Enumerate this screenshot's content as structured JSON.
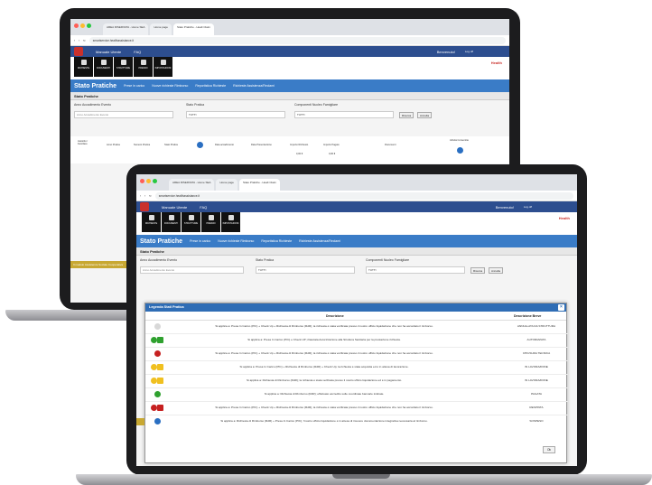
{
  "browser": {
    "tab1": "AREA RISERVATA - Home SEA",
    "tab2": "Home page",
    "tab3": "Stato Pratiche - Healt Claim",
    "url": "smartservice.healthassistance.it"
  },
  "app": {
    "nav_manual": "Manuale Utente",
    "nav_faq": "FAQ",
    "welcome": "Benvenuto!",
    "logout": "Log off",
    "brand": "Health"
  },
  "menu": {
    "items": [
      "RICHIESTE",
      "DOCUMENTI",
      "STRUTTURE",
      "PRESIDI",
      "IMPOSTAZIONI"
    ]
  },
  "page": {
    "title": "Stato Pratiche",
    "links": [
      "Prese in carico",
      "Nuove richieste Rimborso",
      "Reportistica Richieste",
      "Richieste Assistenza/Reclami"
    ],
    "section": "Stato Pratiche"
  },
  "filters": {
    "year_label": "Anno Accadimento Evento",
    "year_placeholder": "Anno Accadimento Evento",
    "state_label": "Stato Pratica",
    "state_value": "TUTTI",
    "family_label": "Componenti Nucleo Famigliare",
    "family_value": "TUTTI",
    "search_btn": "Ricerca",
    "reset_btn": "Annulla"
  },
  "table": {
    "headers": [
      "Assistito / Familiare",
      "Anno Pratica",
      "Numero Pratica",
      "Stato Pratica",
      "Data accadimento",
      "Data Presentazione",
      "Importo Richiesto",
      "Importo Pagato",
      "Documenti",
      "Attività Consentite"
    ],
    "totals": [
      "0,00 €",
      "0,00 €"
    ]
  },
  "footer_strip": "Il modulo Assistenza Sociale Cooperativa",
  "legend": {
    "title": "Legenda Stati Pratica",
    "col_desc": "Descrizione",
    "col_short": "Descrizione Breve",
    "ok": "Ok",
    "rows": [
      {
        "desc": "Si applica a: Presa In Carico (PIC) + Check Up + Richiesta di Rimborso (RdR); la richiesta è stata verificata presso il nostro ufficio liquidazione che non ha accordato il rimborso.",
        "short": "ANNULLATA DA STRUTTURA"
      },
      {
        "desc": "Si applica a: Presa In Carico (PIC) e Check UP; rilasciata Autorizzazione alla Struttura Sanitaria per la prestazione richiesta.",
        "short": "AUTORIZZATA"
      },
      {
        "desc": "Si applica a: Presa In Carico (PIC) + Check Up + Richiesta di Rimborso (RdR); la richiesta è stata verificata presso il nostro ufficio liquidazione che non ha accordato il rimborso.",
        "short": "CHIUSURA TECNICA"
      },
      {
        "desc": "Si applica a: Presa In Carico (PIC) + Richiesta di Rimborso (RdR) + Check Up; la richiesta è stata acquisita ed è in attesa di lavorazione.",
        "short": "IN LAVORAZIONE"
      },
      {
        "desc": "Si applica a: Richiesta di Rimborso (RdR); la richiesta è stata verificata presso il nostro ufficio liquidazione ed è in pagamento.",
        "short": "IN LAVORAZIONE"
      },
      {
        "desc": "Si applica a: Richiesta di Rimborso (RdR); effettuato accredito sulle coordinate bancarie indicate.",
        "short": "PAGATA"
      },
      {
        "desc": "Si applica a: Presa In Carico (PIC) + Check Up + Richiesta di Rimborso (RdR); la richiesta è stata verificata presso il nostro ufficio liquidazione che non ha accordato il rimborso.",
        "short": "RESPINTA"
      },
      {
        "desc": "Si applica a: Richiesta di Rimborso (RdR) + Presa In Carico (PIC); l'nostro ufficio liquidazione è in attesa di ricevere documentazione integrativa necessaria al rimborso.",
        "short": "SOSPESO"
      }
    ]
  },
  "colors": {
    "appbar": "#2d4e8f",
    "titlebar": "#3a7cc7",
    "dialog_head": "#2f6db5"
  }
}
